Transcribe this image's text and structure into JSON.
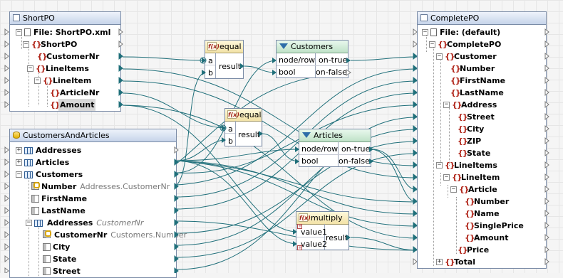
{
  "colors": {
    "wire": "#1f6f7a",
    "component_border": "#7a8ba6",
    "element_icon": "#b02418",
    "title_gradient_top": "#eef3fb",
    "title_gradient_bottom": "#c6d4ea"
  },
  "shortpo": {
    "title": "ShortPO",
    "rows": [
      {
        "icon": "file-icon",
        "label": "File: ShortPO.xml"
      },
      {
        "icon": "element-icon",
        "label": "ShortPO"
      },
      {
        "icon": "element-icon",
        "label": "CustomerNr"
      },
      {
        "icon": "element-icon",
        "label": "LineItems"
      },
      {
        "icon": "element-icon",
        "label": "LineItem"
      },
      {
        "icon": "element-icon",
        "label": "ArticleNr"
      },
      {
        "icon": "element-icon",
        "label": "Amount"
      }
    ]
  },
  "customers_articles": {
    "title": "CustomersAndArticles",
    "rows": [
      {
        "icon": "table-icon",
        "label": "Addresses",
        "sub": ""
      },
      {
        "icon": "table-icon",
        "label": "Articles",
        "sub": ""
      },
      {
        "icon": "table-icon",
        "label": "Customers",
        "sub": ""
      },
      {
        "icon": "key-column-icon",
        "label": "Number",
        "sub": "Addresses.CustomerNr"
      },
      {
        "icon": "column-icon",
        "label": "FirstName",
        "sub": ""
      },
      {
        "icon": "column-icon",
        "label": "LastName",
        "sub": ""
      },
      {
        "icon": "table-icon",
        "label": "Addresses",
        "sub": "CustomerNr"
      },
      {
        "icon": "key-column-icon",
        "label": "CustomerNr",
        "sub": "Customers.Number"
      },
      {
        "icon": "column-icon",
        "label": "City",
        "sub": ""
      },
      {
        "icon": "column-icon",
        "label": "State",
        "sub": ""
      },
      {
        "icon": "column-icon",
        "label": "Street",
        "sub": ""
      }
    ]
  },
  "completepo": {
    "title": "CompletePO",
    "rows": [
      {
        "icon": "file-icon",
        "label": "File: (default)"
      },
      {
        "icon": "element-icon",
        "label": "CompletePO"
      },
      {
        "icon": "element-icon",
        "label": "Customer"
      },
      {
        "icon": "element-icon",
        "label": "Number"
      },
      {
        "icon": "element-icon",
        "label": "FirstName"
      },
      {
        "icon": "element-icon",
        "label": "LastName"
      },
      {
        "icon": "element-icon",
        "label": "Address"
      },
      {
        "icon": "element-icon",
        "label": "Street"
      },
      {
        "icon": "element-icon",
        "label": "City"
      },
      {
        "icon": "element-icon",
        "label": "ZIP"
      },
      {
        "icon": "element-icon",
        "label": "State"
      },
      {
        "icon": "element-icon",
        "label": "LineItems"
      },
      {
        "icon": "element-icon",
        "label": "LineItem"
      },
      {
        "icon": "element-icon",
        "label": "Article"
      },
      {
        "icon": "element-icon",
        "label": "Number"
      },
      {
        "icon": "element-icon",
        "label": "Name"
      },
      {
        "icon": "element-icon",
        "label": "SinglePrice"
      },
      {
        "icon": "element-icon",
        "label": "Amount"
      },
      {
        "icon": "element-icon",
        "label": "Price"
      },
      {
        "icon": "element-icon",
        "label": "Total"
      }
    ]
  },
  "equal1": {
    "title": "equal",
    "in_a": "a",
    "in_b": "b",
    "out": "result"
  },
  "equal2": {
    "title": "equal",
    "in_a": "a",
    "in_b": "b",
    "out": "result"
  },
  "customers_filter": {
    "title": "Customers",
    "in_node": "node/row",
    "in_bool": "bool",
    "out_true": "on-true",
    "out_false": "on-false"
  },
  "articles_filter": {
    "title": "Articles",
    "in_node": "node/row",
    "in_bool": "bool",
    "out_true": "on-true",
    "out_false": "on-false"
  },
  "multiply": {
    "title": "multiply",
    "in_1": "value1",
    "in_2": "value2",
    "out": "result"
  }
}
